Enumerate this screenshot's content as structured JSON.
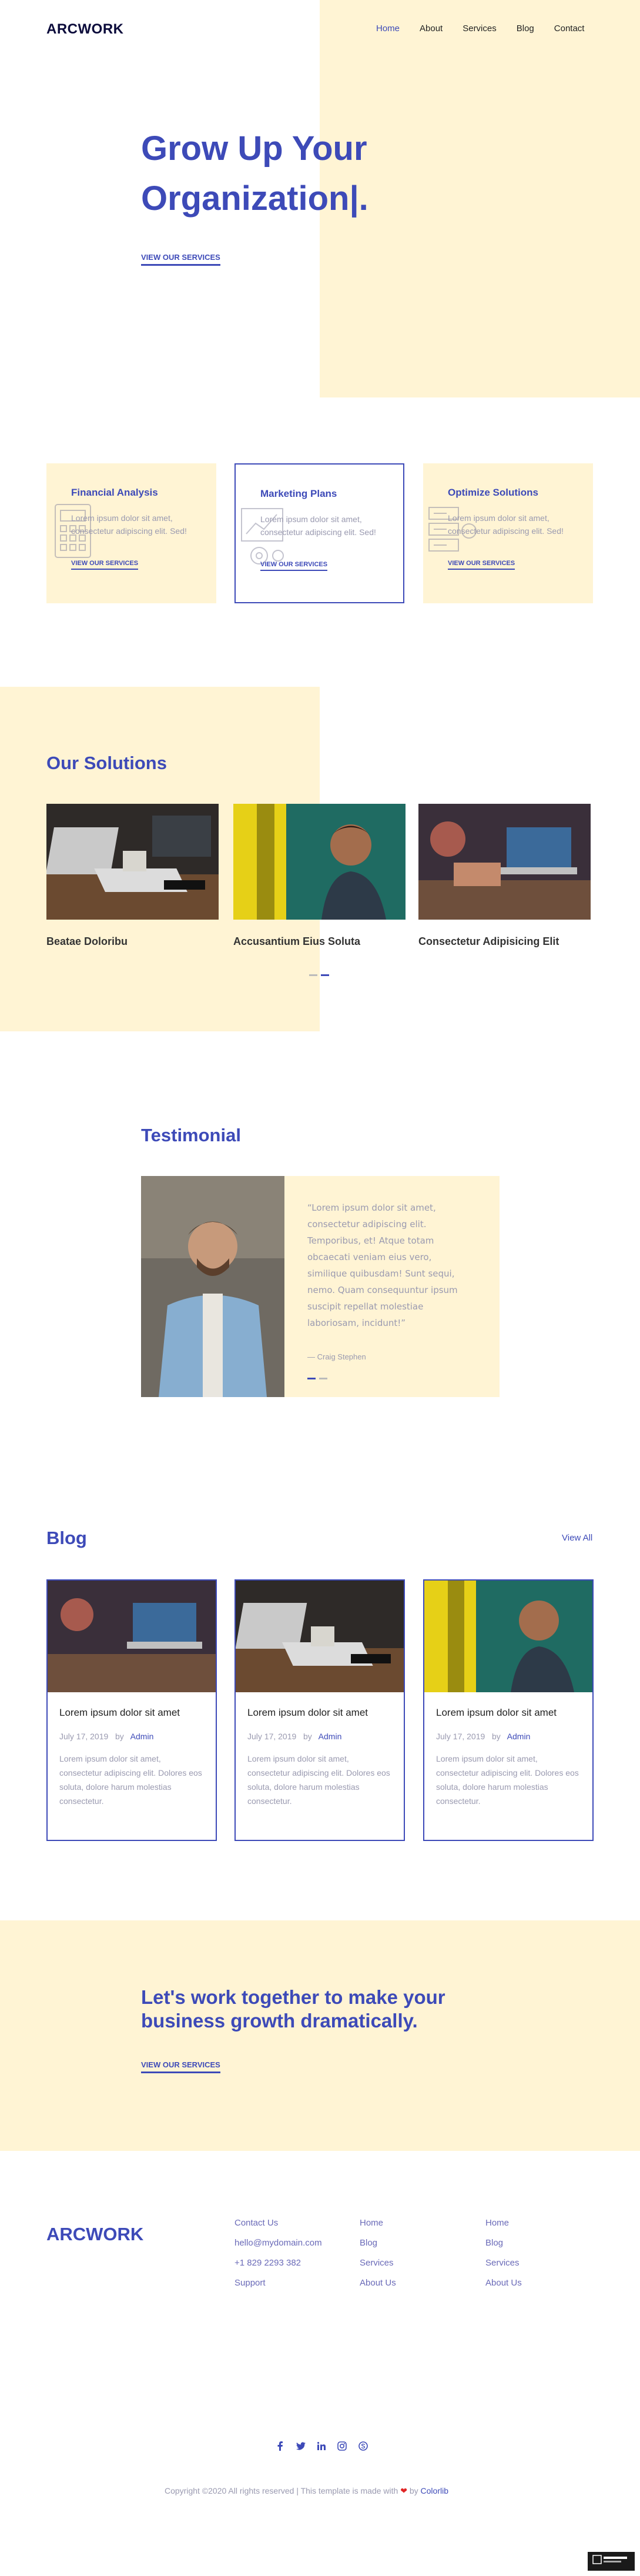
{
  "header": {
    "logo": "ARCWORK",
    "nav": [
      "Home",
      "About",
      "Services",
      "Blog",
      "Contact"
    ]
  },
  "hero": {
    "title_line1": "Grow Up Your",
    "title_line2": "Organization|.",
    "link": "VIEW OUR SERVICES"
  },
  "services": [
    {
      "title": "Financial Analysis",
      "text": "Lorem ipsum dolor sit amet, consectetur adipiscing elit. Sed!",
      "link": "VIEW OUR SERVICES",
      "icon": "calculator-icon"
    },
    {
      "title": "Marketing Plans",
      "text": "Lorem ipsum dolor sit amet, consectetur adipiscing elit. Sed!",
      "link": "VIEW OUR SERVICES",
      "icon": "gear-chart-icon"
    },
    {
      "title": "Optimize Solutions",
      "text": "Lorem ipsum dolor sit amet, consectetur adipiscing elit. Sed!",
      "link": "VIEW OUR SERVICES",
      "icon": "server-icon"
    }
  ],
  "solutions": {
    "heading": "Our Solutions",
    "items": [
      "Beatae Doloribu",
      "Accusantium Eius Soluta",
      "Consectetur Adipisicing Elit"
    ]
  },
  "testimonial": {
    "heading": "Testimonial",
    "quote": "“Lorem ipsum dolor sit amet, consectetur adipiscing elit. Temporibus, et! Atque totam obcaecati veniam eius vero, similique quibusdam! Sunt sequi, nemo. Quam consequuntur ipsum suscipit repellat molestiae laboriosam, incidunt!”",
    "author": "— Craig Stephen"
  },
  "blog": {
    "heading": "Blog",
    "view_all": "View All",
    "posts": [
      {
        "title": "Lorem ipsum dolor sit amet",
        "date": "July 17, 2019",
        "by": "by",
        "author": "Admin",
        "text": "Lorem ipsum dolor sit amet, consectetur adipiscing elit. Dolores eos soluta, dolore harum molestias consectetur."
      },
      {
        "title": "Lorem ipsum dolor sit amet",
        "date": "July 17, 2019",
        "by": "by",
        "author": "Admin",
        "text": "Lorem ipsum dolor sit amet, consectetur adipiscing elit. Dolores eos soluta, dolore harum molestias consectetur."
      },
      {
        "title": "Lorem ipsum dolor sit amet",
        "date": "July 17, 2019",
        "by": "by",
        "author": "Admin",
        "text": "Lorem ipsum dolor sit amet, consectetur adipiscing elit. Dolores eos soluta, dolore harum molestias consectetur."
      }
    ]
  },
  "cta": {
    "title": "Let's work together to make your business growth dramatically.",
    "link": "VIEW OUR SERVICES"
  },
  "footer": {
    "logo": "ARCWORK",
    "col1": [
      "Contact Us",
      "hello@mydomain.com",
      "+1 829 2293 382",
      "Support"
    ],
    "col2": [
      "Home",
      "Blog",
      "Services",
      "About Us"
    ],
    "col3": [
      "Home",
      "Blog",
      "Services",
      "About Us"
    ],
    "social_icons": [
      "facebook-icon",
      "twitter-icon",
      "linkedin-icon",
      "instagram-icon",
      "skype-icon"
    ],
    "copyright_prefix": "Copyright ©2020 All rights reserved | This template is made with",
    "copyright_by": "by",
    "copyright_brand": "Colorlib"
  },
  "colors": {
    "accent": "#3d4ab8",
    "cream": "#fff4d4"
  }
}
